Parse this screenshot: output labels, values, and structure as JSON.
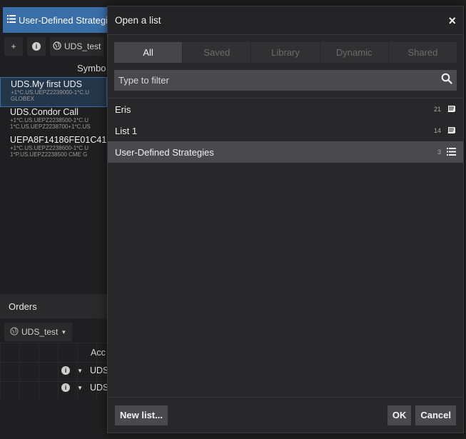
{
  "background": {
    "tab_label": "User-Defined Strategie",
    "toolbar": {
      "add_label": "+",
      "info_label": "i",
      "uds_label": "UDS_test"
    },
    "column_header": "Symbo",
    "rows": [
      {
        "title": "UDS.My first UDS",
        "sub1": "+1*C.US.UEPZ2239000-1*C.U",
        "sub2": "GLOBEX"
      },
      {
        "title": "UDS.Condor Call",
        "sub1": "+1*C.US.UEPZ2238500-1*C.U",
        "sub2": "1*C.US.UEPZ2238700+1*C.US"
      },
      {
        "title": "UEPA8F14186FE01C41",
        "sub1": "+1*C.US.UEPZ2238600-1*C.U",
        "sub2": "1*P.US.UEPZ2238500 CME G"
      }
    ],
    "orders_label": "Orders",
    "orders_uds_label": "UDS_test",
    "acc_header": "Acc",
    "order_rows": [
      "UDS",
      "UDS"
    ],
    "right_edge_glyph": "P"
  },
  "modal": {
    "title": "Open a list",
    "close_glyph": "×",
    "tabs": [
      {
        "label": "All",
        "active": true
      },
      {
        "label": "Saved",
        "active": false
      },
      {
        "label": "Library",
        "active": false
      },
      {
        "label": "Dynamic",
        "active": false
      },
      {
        "label": "Shared",
        "active": false
      }
    ],
    "filter_placeholder": "Type to filter",
    "items": [
      {
        "name": "Eris",
        "count": "21",
        "icon": "book-icon",
        "selected": false
      },
      {
        "name": "List 1",
        "count": "14",
        "icon": "book-icon",
        "selected": false
      },
      {
        "name": "User-Defined Strategies",
        "count": "3",
        "icon": "list-icon",
        "selected": true
      }
    ],
    "new_list_label": "New list...",
    "ok_label": "OK",
    "cancel_label": "Cancel"
  },
  "colors": {
    "accent": "#3a6ea8",
    "modal_bg": "#28282a",
    "selected_row": "#4a4a4e"
  }
}
